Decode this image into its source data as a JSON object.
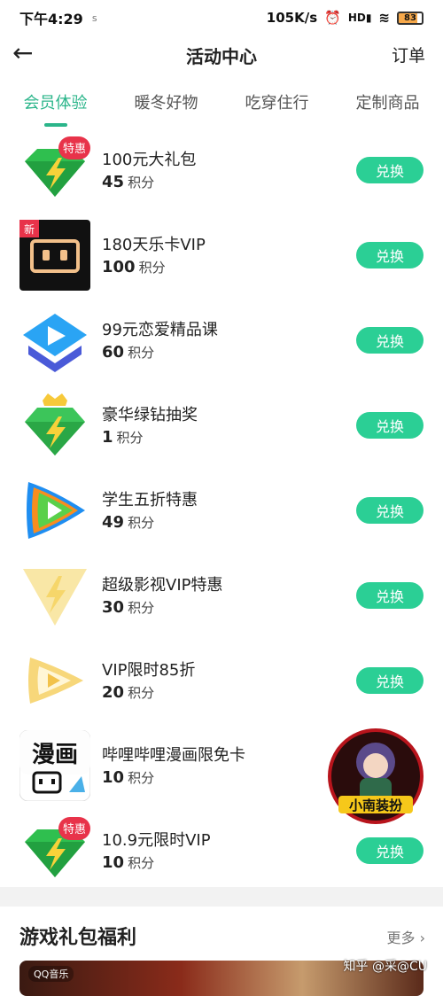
{
  "status": {
    "time": "下午4:29",
    "notif_icon": "s",
    "speed": "105K/s",
    "battery": "83"
  },
  "header": {
    "back_icon": "←",
    "title": "活动中心",
    "orders": "订单"
  },
  "tabs": [
    {
      "label": "会员体验",
      "active": true
    },
    {
      "label": "暖冬好物",
      "active": false
    },
    {
      "label": "吃穿住行",
      "active": false
    },
    {
      "label": "定制商品",
      "active": false
    }
  ],
  "items": [
    {
      "name": "100元大礼包",
      "points": "45",
      "unit": "积分",
      "button": "兑换",
      "badge": "特惠",
      "icon": "green-diamond-icon"
    },
    {
      "name": "180天乐卡VIP",
      "points": "100",
      "unit": "积分",
      "button": "兑换",
      "badge": "新",
      "icon": "black-box-icon"
    },
    {
      "name": "99元恋爱精品课",
      "points": "60",
      "unit": "积分",
      "button": "兑换",
      "badge": "",
      "icon": "blue-play-icon"
    },
    {
      "name": "豪华绿钻抽奖",
      "points": "1",
      "unit": "积分",
      "button": "兑换",
      "badge": "",
      "icon": "crown-diamond-icon"
    },
    {
      "name": "学生五折特惠",
      "points": "49",
      "unit": "积分",
      "button": "兑换",
      "badge": "",
      "icon": "tencent-video-icon"
    },
    {
      "name": "超级影视VIP特惠",
      "points": "30",
      "unit": "积分",
      "button": "兑换",
      "badge": "",
      "icon": "yellow-diamond-icon"
    },
    {
      "name": "VIP限时85折",
      "points": "20",
      "unit": "积分",
      "button": "兑换",
      "badge": "",
      "icon": "gold-play-icon"
    },
    {
      "name": "哔哩哔哩漫画限免卡",
      "points": "10",
      "unit": "积分",
      "button": "兑换",
      "badge": "",
      "icon_text": "漫画",
      "icon": "bilibili-comic-icon"
    },
    {
      "name": "10.9元限时VIP",
      "points": "10",
      "unit": "积分",
      "button": "兑换",
      "badge": "特惠",
      "icon": "green-diamond-icon"
    }
  ],
  "section": {
    "title": "游戏礼包福利",
    "more": "更多"
  },
  "banner": {
    "tag": "QQ音乐"
  },
  "floating": {
    "label": "小南装扮"
  },
  "watermark": "知乎 @采@CU",
  "colors": {
    "accent": "#2bb58a",
    "button": "#2bcf95"
  }
}
